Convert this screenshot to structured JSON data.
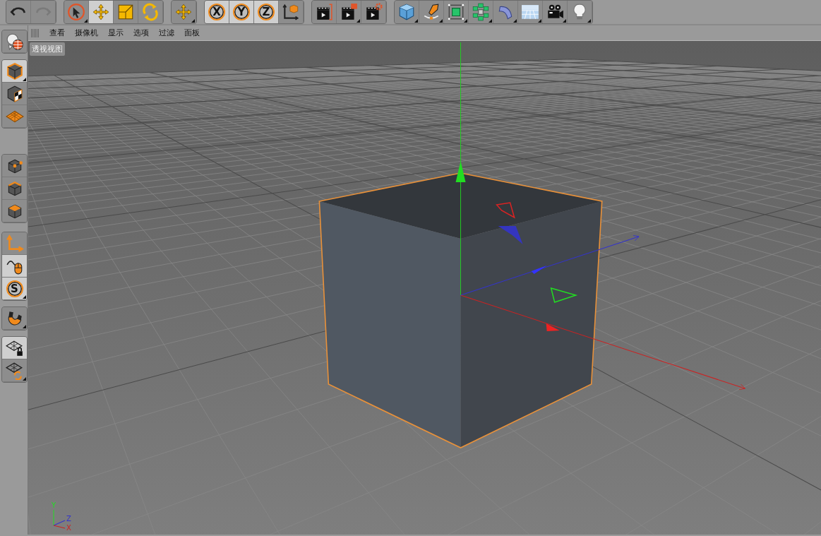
{
  "top_toolbar": {
    "groups": [
      {
        "buttons": [
          {
            "kind": "undo",
            "selected": false,
            "disabled": false,
            "submenu": false
          },
          {
            "kind": "redo",
            "selected": false,
            "disabled": true,
            "submenu": false
          }
        ]
      },
      {
        "buttons": [
          {
            "kind": "select",
            "selected": false,
            "submenu": true
          },
          {
            "kind": "move",
            "selected": true,
            "submenu": false
          },
          {
            "kind": "scale",
            "selected": false,
            "submenu": false
          },
          {
            "kind": "rotate",
            "selected": false,
            "submenu": false
          }
        ]
      },
      {
        "buttons": [
          {
            "kind": "move",
            "selected": false,
            "submenu": true
          }
        ]
      },
      {
        "buttons": [
          {
            "kind": "letter",
            "label": "X",
            "selected": true,
            "submenu": false
          },
          {
            "kind": "letter",
            "label": "Y",
            "selected": true,
            "submenu": false
          },
          {
            "kind": "letter",
            "label": "Z",
            "selected": true,
            "submenu": false
          },
          {
            "kind": "coords",
            "selected": false,
            "submenu": false
          }
        ]
      },
      {
        "buttons": [
          {
            "kind": "render-view",
            "selected": false,
            "submenu": false
          },
          {
            "kind": "render-picture",
            "selected": false,
            "submenu": true
          },
          {
            "kind": "render-settings",
            "selected": false,
            "submenu": false
          }
        ]
      },
      {
        "buttons": [
          {
            "kind": "cube",
            "selected": false,
            "submenu": true
          },
          {
            "kind": "pen",
            "selected": false,
            "submenu": true
          },
          {
            "kind": "subdivision",
            "selected": false,
            "submenu": true
          },
          {
            "kind": "cloner",
            "selected": false,
            "submenu": true
          },
          {
            "kind": "bend",
            "selected": false,
            "submenu": true
          },
          {
            "kind": "floor",
            "selected": false,
            "submenu": true
          },
          {
            "kind": "camera",
            "selected": false,
            "submenu": true
          },
          {
            "kind": "light",
            "selected": false,
            "submenu": true
          }
        ]
      }
    ]
  },
  "left_toolbar": {
    "groups": [
      {
        "buttons": [
          {
            "kind": "globe",
            "selected": false,
            "submenu": false
          }
        ]
      },
      {
        "buttons": [
          {
            "kind": "model",
            "selected": true,
            "submenu": true
          },
          {
            "kind": "texture",
            "selected": false,
            "submenu": false
          },
          {
            "kind": "workplane",
            "selected": false,
            "submenu": false
          }
        ]
      },
      {
        "buttons": [
          {
            "kind": "points",
            "selected": false,
            "submenu": false
          },
          {
            "kind": "edges",
            "selected": false,
            "submenu": false
          },
          {
            "kind": "polygons",
            "selected": false,
            "submenu": false
          }
        ]
      },
      {
        "buttons": [
          {
            "kind": "axis",
            "selected": false,
            "submenu": false
          },
          {
            "kind": "tweak",
            "selected": true,
            "submenu": false
          },
          {
            "kind": "letter",
            "label": "S",
            "selected": true,
            "submenu": true
          }
        ]
      },
      {
        "buttons": [
          {
            "kind": "snap",
            "selected": false,
            "submenu": true
          }
        ]
      },
      {
        "buttons": [
          {
            "kind": "lock-workplane",
            "selected": true,
            "submenu": false
          },
          {
            "kind": "workplane-sync",
            "selected": false,
            "submenu": true
          }
        ]
      }
    ]
  },
  "viewport": {
    "menu": [
      "查看",
      "摄像机",
      "显示",
      "选项",
      "过滤",
      "面板"
    ],
    "view_label": "透视视图",
    "axis_gizmo": {
      "labels": [
        "Y",
        "Z",
        "X"
      ]
    }
  }
}
